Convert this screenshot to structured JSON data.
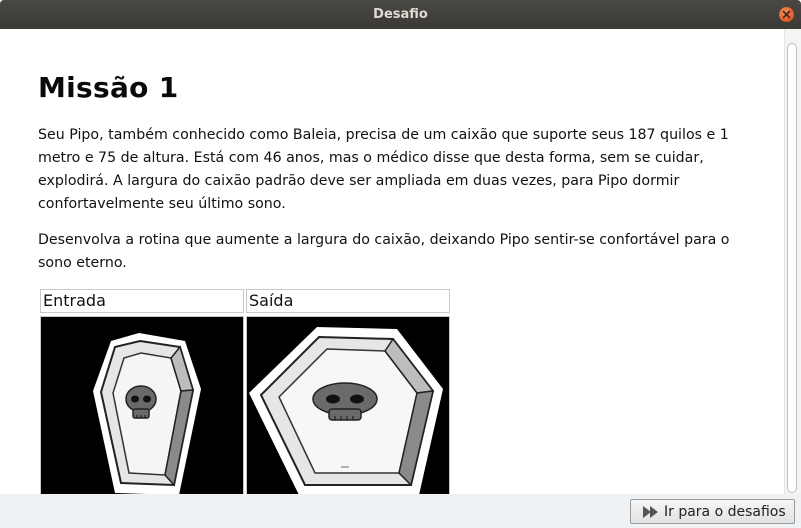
{
  "window": {
    "title": "Desafio"
  },
  "main": {
    "title": "Missão 1",
    "paragraph1": "Seu Pipo, também conhecido como Baleia, precisa de um caixão que suporte seus 187 quilos e 1 metro e 75 de altura. Está com 46 anos, mas o médico disse que desta forma, sem se cuidar, explodirá. A largura do caixão padrão deve ser ampliada em duas vezes, para Pipo dormir confortavelmente seu último sono.",
    "paragraph2": "Desenvolva a rotina que aumente a largura do caixão, deixando Pipo sentir-se confortável para o sono eterno.",
    "io_table": {
      "input_header": "Entrada",
      "output_header": "Saída"
    }
  },
  "footer": {
    "go_button_label": "Ir para o desafios"
  },
  "icons": {
    "close": "close-icon",
    "go": "fast-forward-icon"
  },
  "colors": {
    "titlebar": "#3c3b37",
    "close_button": "#e8612c",
    "image_background": "#000000"
  }
}
